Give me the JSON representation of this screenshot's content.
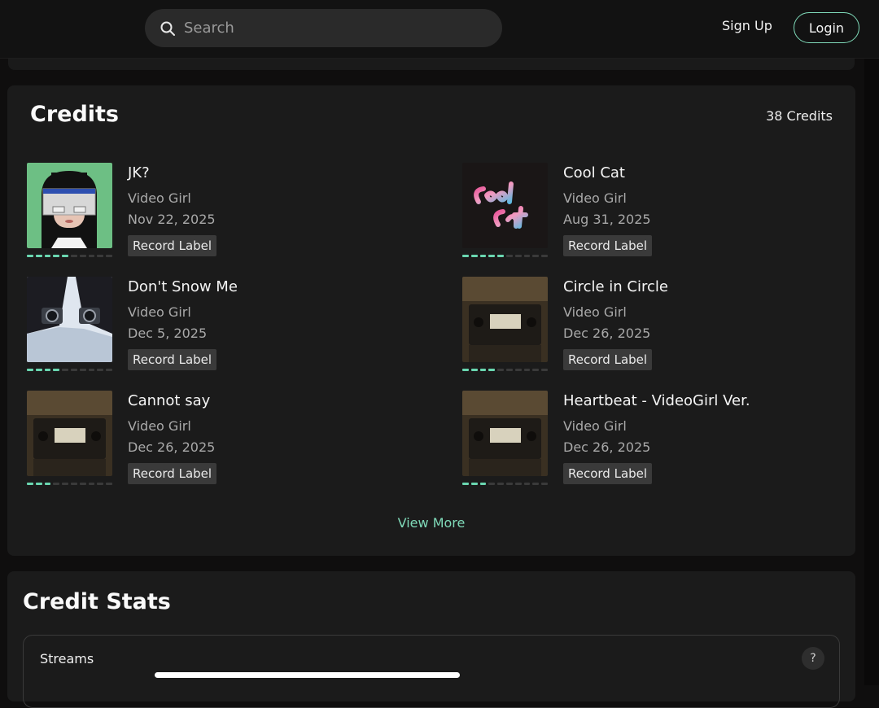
{
  "header": {
    "search_placeholder": "Search",
    "signup_label": "Sign Up",
    "login_label": "Login"
  },
  "credits": {
    "title": "Credits",
    "count": "38 Credits",
    "view_more": "View More",
    "items": [
      {
        "title": "JK?",
        "artist": "Video Girl",
        "date": "Nov 22, 2025",
        "badge": "Record Label",
        "progress": 0.5
      },
      {
        "title": "Cool Cat",
        "artist": "Video Girl",
        "date": "Aug 31, 2025",
        "badge": "Record Label",
        "progress": 0.5
      },
      {
        "title": "Don't Snow Me",
        "artist": "Video Girl",
        "date": "Dec 5, 2025",
        "badge": "Record Label",
        "progress": 0.4
      },
      {
        "title": "Circle in Circle",
        "artist": "Video Girl",
        "date": "Dec 26, 2025",
        "badge": "Record Label",
        "progress": 0.4
      },
      {
        "title": "Cannot say",
        "artist": "Video Girl",
        "date": "Dec 26, 2025",
        "badge": "Record Label",
        "progress": 0.3
      },
      {
        "title": "Heartbeat - VideoGirl Ver.",
        "artist": "Video Girl",
        "date": "Dec 26, 2025",
        "badge": "Record Label",
        "progress": 0.3
      }
    ]
  },
  "stats": {
    "title": "Credit Stats",
    "streams_label": "Streams",
    "help_label": "?"
  },
  "colors": {
    "accent": "#7fd9b8",
    "card": "#1b1b1b",
    "background": "#0f0e0e"
  }
}
